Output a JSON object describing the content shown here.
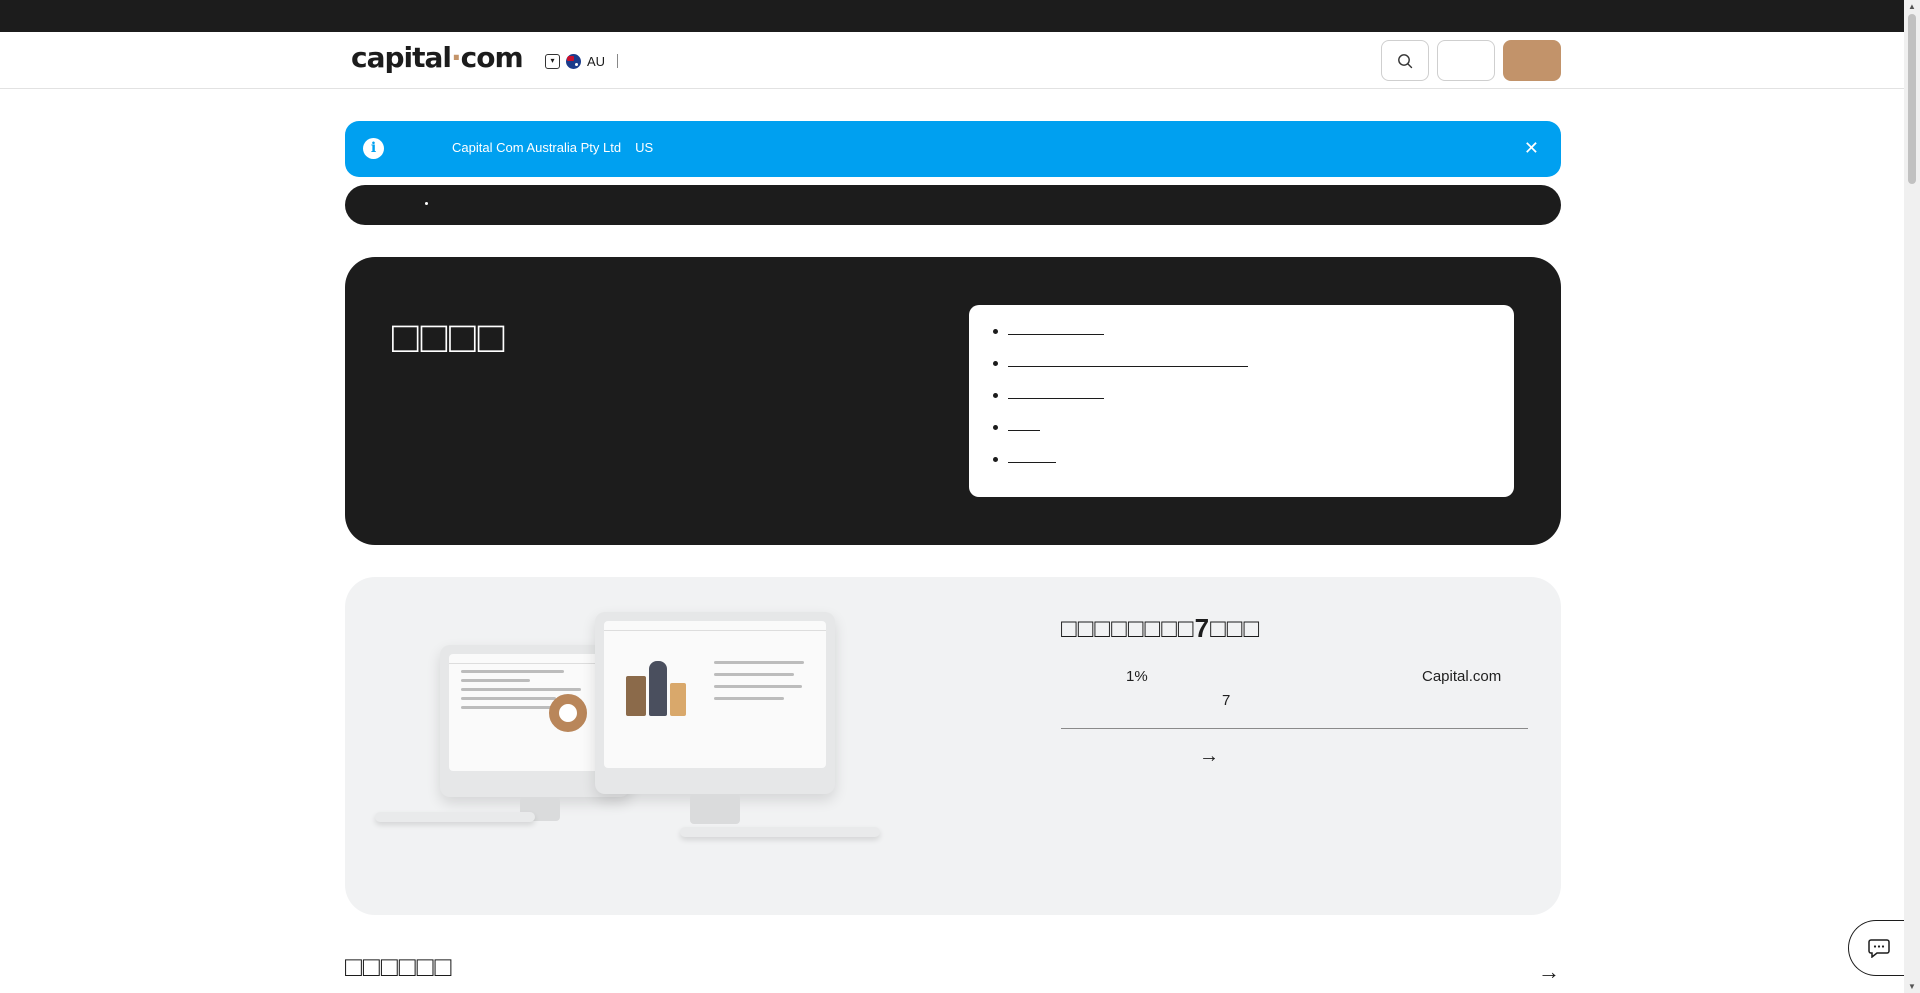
{
  "header": {
    "logo_main": "capital",
    "logo_dot": "·",
    "logo_tld": "com",
    "region_code": "AU",
    "icons": [
      "chevron-down-icon",
      "australia-flag-icon",
      "search-icon"
    ],
    "colors": {
      "accent": "#c2936a",
      "dark": "#1c1c1c"
    }
  },
  "banner": {
    "entity": "Capital Com Australia Pty Ltd",
    "country": "US",
    "close": "✕",
    "color": "#00a0f0"
  },
  "hero": {
    "title": "□□□□",
    "toc_items": [
      "",
      "",
      "",
      "",
      ""
    ]
  },
  "promo": {
    "title": "□□□□□□□□7□□□",
    "line1_start": "1%",
    "line1_end": "Capital.com",
    "line2": "7",
    "arrow": "→"
  },
  "section": {
    "title": "□□□□□□",
    "arrow": "→"
  }
}
